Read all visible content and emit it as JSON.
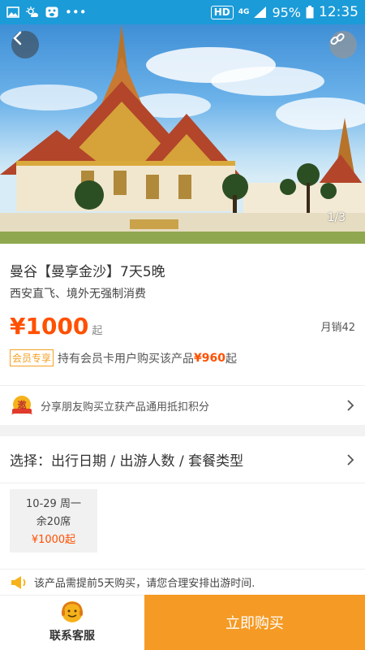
{
  "status_bar": {
    "hd": "HD",
    "network": "4G",
    "battery": "95%",
    "time": "12:35"
  },
  "hero": {
    "pager": "1/3"
  },
  "product": {
    "title": "曼谷【曼享金沙】7天5晚",
    "subtitle": "西安直飞、境外无强制消费",
    "price": "¥1000",
    "price_suffix": "起",
    "monthly_sales": "月销42"
  },
  "member": {
    "tag": "会员专享",
    "text": "持有会员卡用户购买该产品",
    "price": "¥960",
    "suffix": "起"
  },
  "share": {
    "badge": "邀",
    "text": "分享朋友购买立获产品通用抵扣积分"
  },
  "selection": {
    "label": "选择：出行日期 / 出游人数 / 套餐类型"
  },
  "date_card": {
    "date": "10-29 周一",
    "seats": "余20席",
    "price": "¥1000起"
  },
  "notice": {
    "text": "该产品需提前5天购买，请您合理安排出游时间."
  },
  "bottom_bar": {
    "service_label": "联系客服",
    "buy_label": "立即购买"
  },
  "colors": {
    "accent_orange": "#f59a24",
    "price_red": "#ff5000",
    "status_bar_blue": "#1b9bd8"
  }
}
